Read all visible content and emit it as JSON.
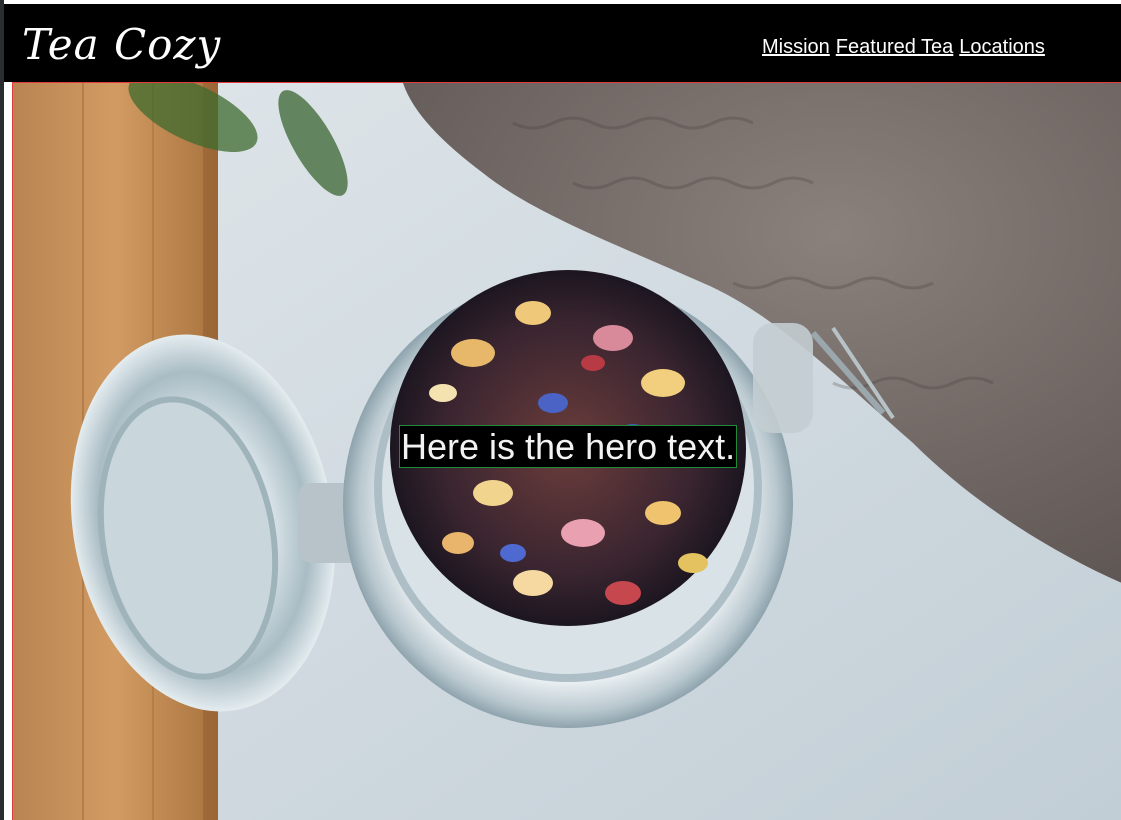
{
  "header": {
    "logo_text": "Tea Cozy",
    "nav": [
      {
        "label": "Mission"
      },
      {
        "label": "Featured Tea"
      },
      {
        "label": "Locations"
      }
    ]
  },
  "hero": {
    "text": "Here is the hero text.",
    "image": "tea-jar-photo"
  },
  "colors": {
    "header_bg": "#000000",
    "nav_link": "#ffffff",
    "hero_border": "#e23b3b",
    "hero_text_bg": "#000000",
    "hero_text_border": "#1e8a3a"
  }
}
